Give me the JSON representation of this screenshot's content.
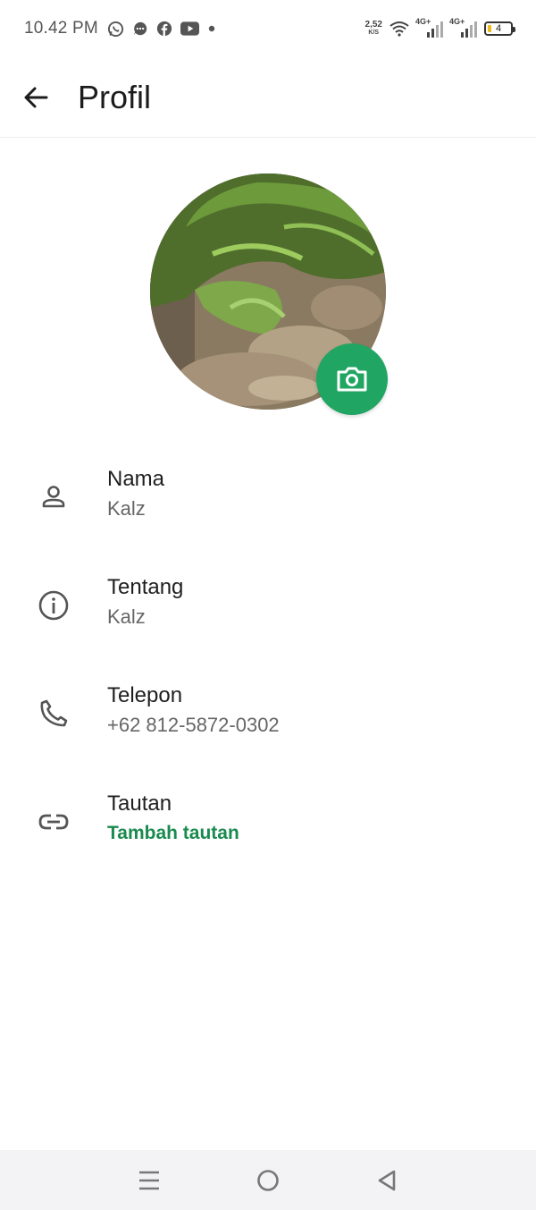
{
  "status_bar": {
    "time": "10.42 PM",
    "notification_icons": [
      "whatsapp-icon",
      "message-icon",
      "facebook-icon",
      "youtube-icon",
      "dot-icon"
    ],
    "net_speed_value": "2,52",
    "net_speed_unit": "K/S",
    "signal1_label": "4G+",
    "signal2_label": "4G+",
    "battery_level": "4"
  },
  "app_bar": {
    "title": "Profil"
  },
  "profile": {
    "fields": [
      {
        "label": "Nama",
        "value": "Kalz",
        "icon": "person-icon"
      },
      {
        "label": "Tentang",
        "value": "Kalz",
        "icon": "info-icon"
      },
      {
        "label": "Telepon",
        "value": "+62 812-5872-0302",
        "icon": "phone-icon"
      },
      {
        "label": "Tautan",
        "value": "Tambah tautan",
        "icon": "link-icon"
      }
    ]
  },
  "colors": {
    "accent": "#21a562",
    "link_text": "#1a8a4f",
    "battery_fill": "#f1b81d"
  }
}
